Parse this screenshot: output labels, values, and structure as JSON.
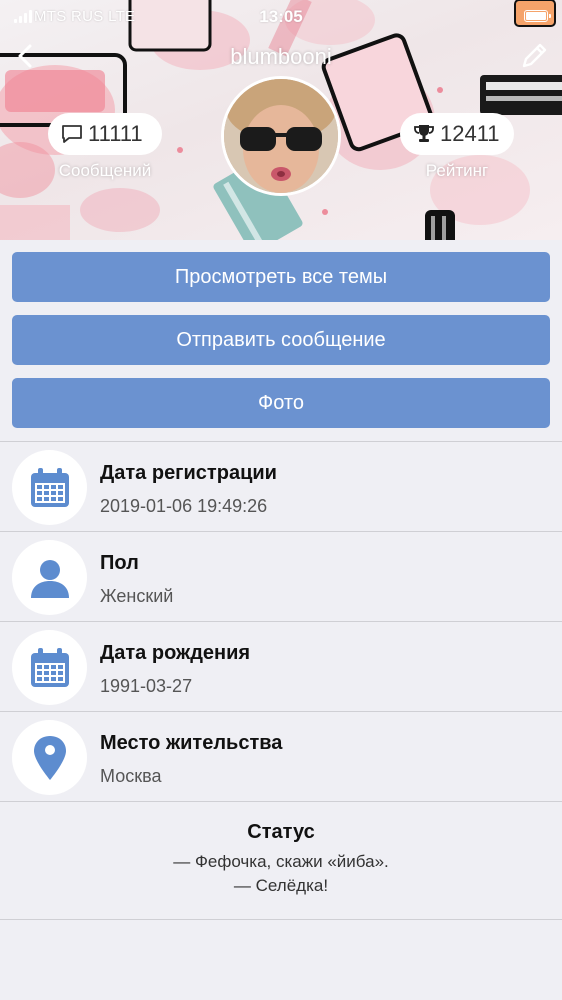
{
  "status_bar": {
    "carrier": "MTS RUS  LTE",
    "time": "13:05"
  },
  "header": {
    "username": "blumbooni",
    "messages_count": "11111",
    "messages_label": "Сообщений",
    "rating_count": "12411",
    "rating_label": "Рейтинг",
    "icons": {
      "back": "chevron-left-icon",
      "edit": "pencil-icon",
      "messages": "speech-bubble-icon",
      "rating": "trophy-icon"
    }
  },
  "actions": {
    "view_topics": "Просмотреть все темы",
    "send_message": "Отправить сообщение",
    "photo": "Фото"
  },
  "info": [
    {
      "title": "Дата регистрации",
      "value": "2019-01-06 19:49:26",
      "icon": "calendar-icon"
    },
    {
      "title": "Пол",
      "value": "Женский",
      "icon": "person-icon"
    },
    {
      "title": "Дата рождения",
      "value": "1991-03-27",
      "icon": "calendar-icon"
    },
    {
      "title": "Место жительства",
      "value": "Москва",
      "icon": "map-pin-icon"
    }
  ],
  "status": {
    "title": "Статус",
    "line1": "— Фефочка, скажи «йиба».",
    "line2": "— Селёдка!"
  },
  "colors": {
    "accent": "#6b92d0",
    "icon": "#5d8ccf",
    "background": "#efeff4"
  }
}
